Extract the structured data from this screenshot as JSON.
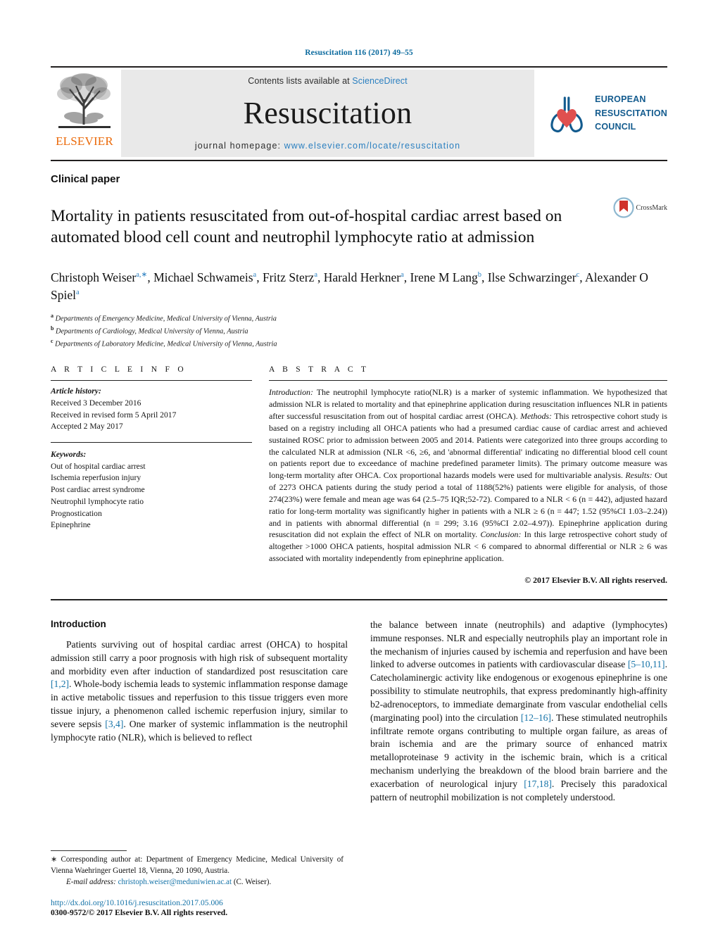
{
  "running_head": "Resuscitation 116 (2017) 49–55",
  "masthead": {
    "publisher_name": "ELSEVIER",
    "contents_prefix": "Contents lists available at ",
    "contents_link": "ScienceDirect",
    "journal_name": "Resuscitation",
    "homepage_prefix": "journal homepage: ",
    "homepage_url": "www.elsevier.com/locate/resuscitation",
    "erc_lines": [
      "EUROPEAN",
      "RESUSCITATION",
      "COUNCIL"
    ]
  },
  "article": {
    "kicker": "Clinical paper",
    "title": "Mortality in patients resuscitated from out-of-hospital cardiac arrest based on automated blood cell count and neutrophil lymphocyte ratio at admission",
    "crossmark_label": "CrossMark",
    "authors_html": "Christoph Weiser<sup>a,∗</sup>, Michael Schwameis<sup>a</sup>, Fritz Sterz<sup>a</sup>, Harald Herkner<sup>a</sup>, Irene M Lang<sup>b</sup>, Ilse Schwarzinger<sup>c</sup>, Alexander O Spiel<sup>a</sup>",
    "affiliations": [
      {
        "marker": "a",
        "text": "Departments of Emergency Medicine, Medical University of Vienna, Austria"
      },
      {
        "marker": "b",
        "text": "Departments of Cardiology, Medical University of Vienna, Austria"
      },
      {
        "marker": "c",
        "text": "Departments of Laboratory Medicine, Medical University of Vienna, Austria"
      }
    ]
  },
  "article_info": {
    "heading": "A R T I C L E   I N F O",
    "history_label": "Article history:",
    "history": [
      "Received 3 December 2016",
      "Received in revised form 5 April 2017",
      "Accepted 2 May 2017"
    ],
    "keywords_label": "Keywords:",
    "keywords": [
      "Out of hospital cardiac arrest",
      "Ischemia reperfusion injury",
      "Post cardiac arrest syndrome",
      "Neutrophil lymphocyte ratio",
      "Prognostication",
      "Epinephrine"
    ]
  },
  "abstract": {
    "heading": "A B S T R A C T",
    "sections": [
      {
        "label": "Introduction:",
        "text": " The neutrophil lymphocyte ratio(NLR) is a marker of systemic inflammation. We hypothesized that admission NLR is related to mortality and that epinephrine application during resuscitation influences NLR in patients after successful resuscitation from out of hospital cardiac arrest (OHCA)."
      },
      {
        "label": "Methods:",
        "text": " This retrospective cohort study is based on a registry including all OHCA patients who had a presumed cardiac cause of cardiac arrest and achieved sustained ROSC prior to admission between 2005 and 2014. Patients were categorized into three groups according to the calculated NLR at admission (NLR <6, ≥6, and 'abnormal differential' indicating no differential blood cell count on patients report due to exceedance of machine predefined parameter limits). The primary outcome measure was long-term mortality after OHCA. Cox proportional hazards models were used for multivariable analysis."
      },
      {
        "label": "Results:",
        "text": " Out of 2273 OHCA patients during the study period a total of 1188(52%) patients were eligible for analysis, of those 274(23%) were female and mean age was 64 (2.5–75 IQR;52-72). Compared to a NLR < 6 (n = 442), adjusted hazard ratio for long-term mortality was significantly higher in patients with a NLR ≥ 6 (n = 447; 1.52 (95%CI 1.03–2.24)) and in patients with abnormal differential (n = 299; 3.16 (95%CI 2.02–4.97)). Epinephrine application during resuscitation did not explain the effect of NLR on mortality."
      },
      {
        "label": "Conclusion:",
        "text": " In this large retrospective cohort study of altogether >1000 OHCA patients, hospital admission NLR < 6 compared to abnormal differential or NLR ≥ 6 was associated with mortality independently from epinephrine application."
      }
    ],
    "copyright": "© 2017 Elsevier B.V. All rights reserved."
  },
  "introduction": {
    "heading": "Introduction",
    "left_paragraph_parts": [
      "Patients surviving out of hospital cardiac arrest (OHCA) to hospital admission still carry a poor prognosis with high risk of subsequent mortality and morbidity even after induction of standardized post resuscitation care ",
      "[1,2]",
      ". Whole-body ischemia leads to systemic inflammation response damage in active metabolic tissues and reperfusion to this tissue triggers even more tissue injury, a phenomenon called ischemic reperfusion injury, similar to severe sepsis ",
      "[3,4]",
      ". One marker of systemic inflammation is the neutrophil lymphocyte ratio (NLR), which is believed to reflect"
    ],
    "right_paragraph_parts": [
      "the balance between innate (neutrophils) and adaptive (lymphocytes) immune responses. NLR and especially neutrophils play an important role in the mechanism of injuries caused by ischemia and reperfusion and have been linked to adverse outcomes in patients with cardiovascular disease ",
      "[5–10,11]",
      ". Catecholaminergic activity like endogenous or exogenous epinephrine is one possibility to stimulate neutrophils, that express predominantly high-affinity b2-adrenoceptors, to immediate demarginate from vascular endothelial cells (marginating pool) into the circulation ",
      "[12–16]",
      ". These stimulated neutrophils infiltrate remote organs contributing to multiple organ failure, as areas of brain ischemia and are the primary source of enhanced matrix metalloproteinase 9 activity in the ischemic brain, which is a critical mechanism underlying the breakdown of the blood brain barriere and the exacerbation of neurological injury ",
      "[17,18]",
      ". Precisely this paradoxical pattern of neutrophil mobilization is not completely understood."
    ]
  },
  "footnote": {
    "corresponding_star": "∗",
    "corresponding_text": " Corresponding author at: Department of Emergency Medicine, Medical University of Vienna Waehringer Guertel 18, Vienna, 20 1090, Austria.",
    "email_label": "E-mail address:",
    "email": "christoph.weiser@meduniwien.ac.at",
    "email_suffix": " (C. Weiser).",
    "doi": "http://dx.doi.org/10.1016/j.resuscitation.2017.05.006",
    "issn_line": "0300-9572/© 2017 Elsevier B.V. All rights reserved."
  },
  "colors": {
    "link_blue": "#1573a8",
    "sd_blue": "#2a7fc0",
    "elsevier_orange": "#eb6a0a",
    "erc_blue": "#135b8e",
    "erc_red": "#e0504f",
    "band_gray": "#e9e9e9"
  }
}
